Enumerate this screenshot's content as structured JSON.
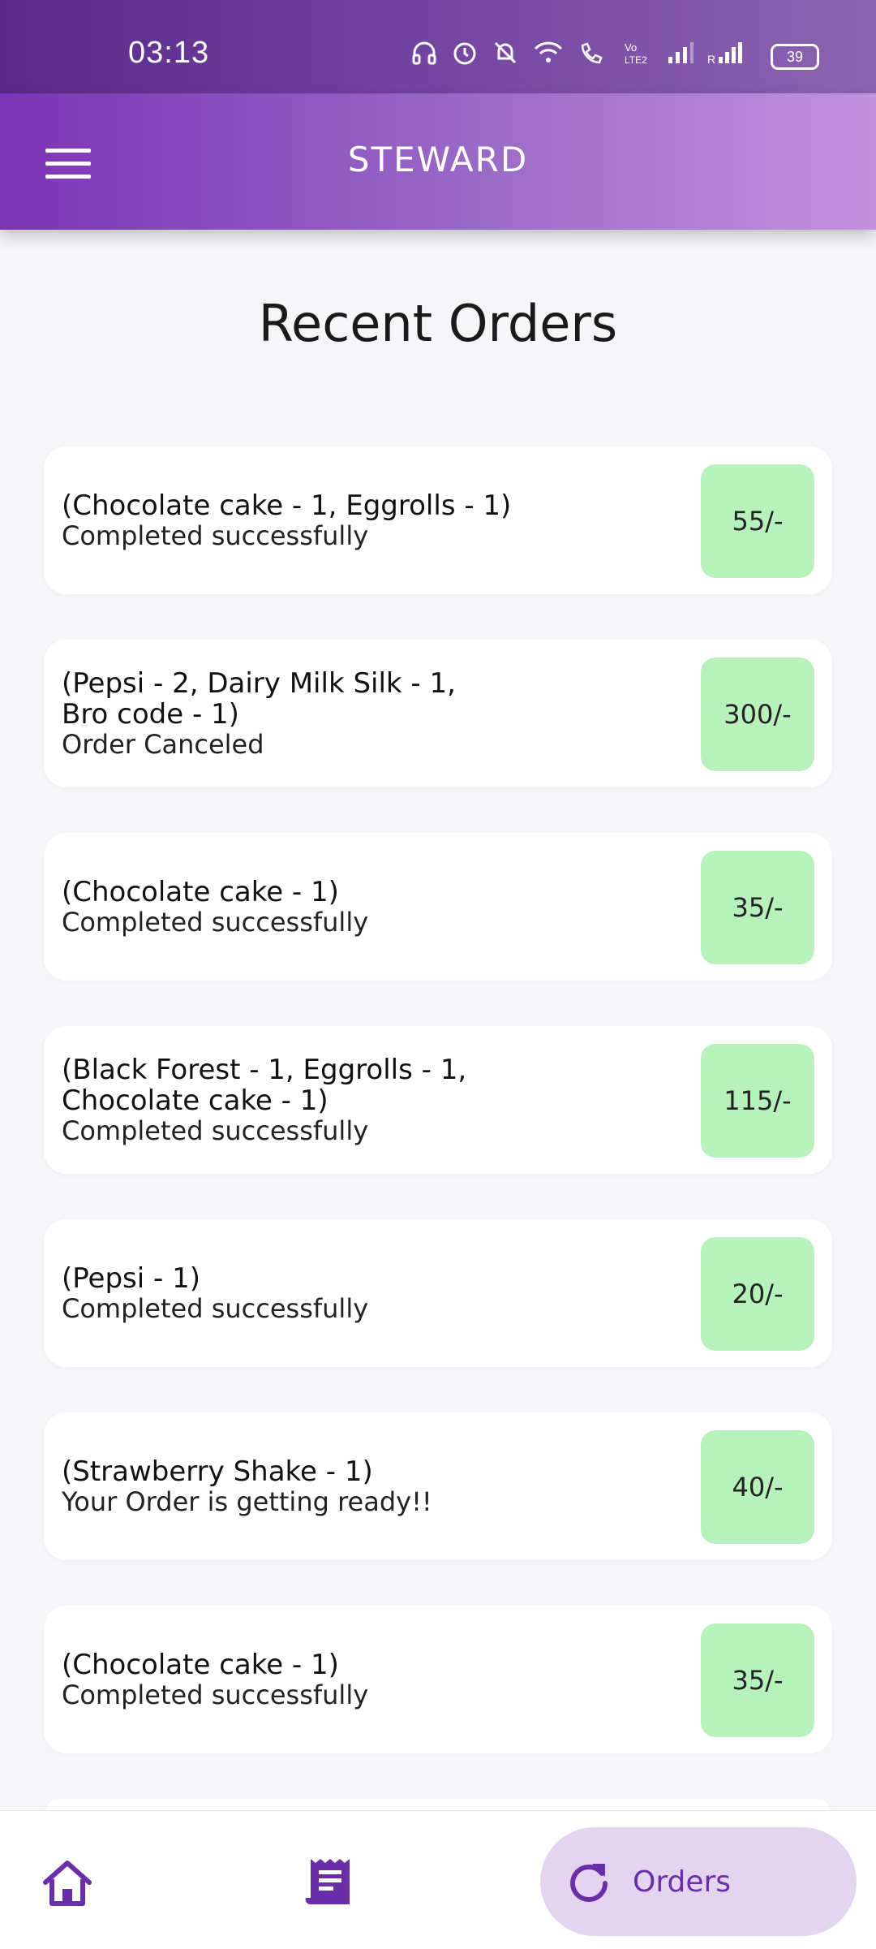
{
  "status_bar": {
    "time": "03:13",
    "battery": "39"
  },
  "app_bar": {
    "title": "STEWARD"
  },
  "page": {
    "heading": "Recent Orders"
  },
  "orders": [
    {
      "items": "(Chocolate cake - 1, Eggrolls - 1)",
      "status": "Completed successfully",
      "price": "55/-"
    },
    {
      "items": "(Pepsi - 2, Dairy Milk Silk - 1, Bro code - 1)",
      "status": "Order Canceled",
      "price": "300/-"
    },
    {
      "items": "(Chocolate cake - 1)",
      "status": "Completed successfully",
      "price": "35/-"
    },
    {
      "items": "(Black Forest  - 1, Eggrolls - 1, Chocolate cake - 1)",
      "status": "Completed successfully",
      "price": "115/-"
    },
    {
      "items": "(Pepsi - 1)",
      "status": "Completed successfully",
      "price": "20/-"
    },
    {
      "items": "(Strawberry Shake - 1)",
      "status": "Your Order is getting ready!!",
      "price": "40/-"
    },
    {
      "items": "(Chocolate cake - 1)",
      "status": "Completed successfully",
      "price": "35/-"
    }
  ],
  "bottom_nav": {
    "items": [
      {
        "icon": "home-icon"
      },
      {
        "icon": "receipt-icon"
      },
      {
        "icon": "refresh-icon",
        "label": "Orders",
        "active": true
      }
    ]
  },
  "colors": {
    "accent": "#7a35b6",
    "price_badge": "#b7f2bc",
    "active_nav_bg": "#e3d4ef"
  }
}
